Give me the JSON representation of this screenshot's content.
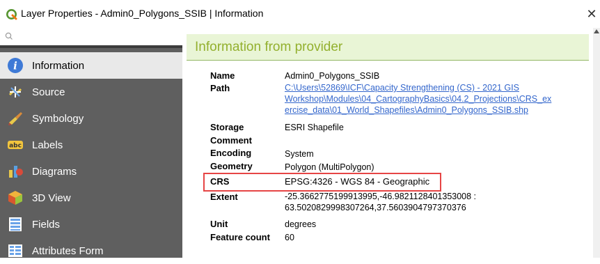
{
  "window": {
    "title": "Layer Properties - Admin0_Polygons_SSIB | Information",
    "close_glyph": "✕"
  },
  "search": {
    "placeholder": ""
  },
  "sidebar": {
    "items": [
      {
        "label": "Information",
        "icon": "info-icon"
      },
      {
        "label": "Source",
        "icon": "source-icon"
      },
      {
        "label": "Symbology",
        "icon": "symbology-icon"
      },
      {
        "label": "Labels",
        "icon": "labels-icon"
      },
      {
        "label": "Diagrams",
        "icon": "diagrams-icon"
      },
      {
        "label": "3D View",
        "icon": "3d-view-icon"
      },
      {
        "label": "Fields",
        "icon": "fields-icon"
      },
      {
        "label": "Attributes Form",
        "icon": "attributes-form-icon"
      }
    ]
  },
  "content": {
    "section_title": "Information from provider",
    "rows": [
      {
        "label": "Name",
        "value": "Admin0_Polygons_SSIB"
      },
      {
        "label": "Path",
        "value_lines": [
          "C:\\Users\\52869\\ICF\\Capacity Strengthening (CS) - 2021 GIS",
          "Workshop\\Modules\\04_CartographyBasics\\04.2_Projections\\CRS_ex",
          "ercise_data\\01_World_Shapefiles\\Admin0_Polygons_SSIB.shp"
        ]
      },
      {
        "label": "Storage",
        "value": "ESRI Shapefile"
      },
      {
        "label": "Comment",
        "value": ""
      },
      {
        "label": "Encoding",
        "value": "System"
      },
      {
        "label": "Geometry",
        "value": "Polygon (MultiPolygon)"
      },
      {
        "label": "CRS",
        "value": "EPSG:4326 - WGS 84 - Geographic"
      },
      {
        "label": "Extent",
        "value_lines": [
          "-25.3662775199913995,-46.9821128401353008 :",
          "63.5020829998307264,37.5603904797370376"
        ]
      },
      {
        "label": "Unit",
        "value": "degrees"
      },
      {
        "label": "Feature count",
        "value": "60"
      }
    ]
  },
  "colors": {
    "sidebar_bg": "#5f5f5f",
    "header_bg": "#e9f5d6",
    "header_text": "#93b02e",
    "link": "#3366cc",
    "highlight": "#e64545"
  }
}
